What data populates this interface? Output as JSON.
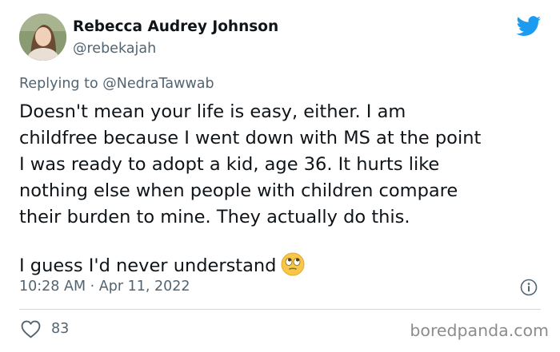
{
  "author": {
    "display_name": "Rebecca Audrey Johnson",
    "handle": "@rebekajah"
  },
  "reply": {
    "prefix": "Replying to ",
    "mention": "@NedraTawwab"
  },
  "tweet": {
    "paragraph_1_lines": [
      "Doesn't mean your life is easy, either. I am",
      "childfree because I went down with MS at the point",
      "I was ready to adopt a kid, age 36. It hurts like",
      "nothing else when people with children compare",
      "their burden to mine. They actually do this."
    ],
    "paragraph_2": "I guess I'd never understand",
    "emoji": "face-with-rolling-eyes"
  },
  "meta": {
    "timestamp": "10:28 AM · Apr 11, 2022"
  },
  "engagement": {
    "likes": "83"
  },
  "watermark": "boredpanda.com",
  "icons": [
    "twitter-bird-icon",
    "info-icon",
    "heart-icon",
    "rolling-eyes-emoji-icon"
  ],
  "colors": {
    "twitter_blue": "#1d9bf0",
    "text_primary": "#0f1419",
    "text_secondary": "#536471",
    "divider": "#cfd9de"
  }
}
